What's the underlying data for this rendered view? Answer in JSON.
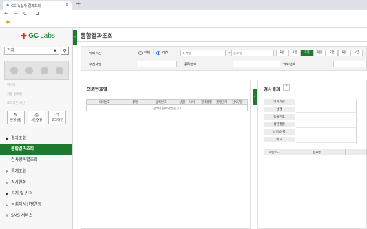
{
  "browser": {
    "tab_title": "GC 녹십자 결과조회",
    "new_tab": "+",
    "nav_back": "←",
    "nav_forward": "→",
    "nav_reload": "C"
  },
  "sidebar": {
    "logo_text_gc": "GC",
    "logo_text_labs": "Labs",
    "select_value": "전체",
    "links": [
      "마이디",
      "최종 접속일",
      "로그아웃 시간"
    ],
    "buttons": [
      "환경설정",
      "서인연장",
      "로그아웃"
    ],
    "menu": [
      {
        "label": "결과조회",
        "icon": "person-icon"
      },
      {
        "label": "통합결과조회",
        "active": true
      },
      {
        "label": "검사항목별조회"
      },
      {
        "label": "통계조회",
        "icon": "search-icon"
      },
      {
        "label": "검사현황",
        "icon": "list-icon"
      },
      {
        "label": "공지 및 신청",
        "icon": "chat-icon"
      },
      {
        "label": "녹십자서신쟁연동",
        "icon": "sync-icon"
      },
      {
        "label": "SMS 서비스",
        "icon": "mail-icon"
      }
    ]
  },
  "main": {
    "title": "통합결과조회",
    "filters": {
      "period_label": "의뢰기간",
      "radio_all": "전체",
      "radio_period": "기간",
      "start_placeholder": "시작일",
      "end_placeholder": "종료일",
      "tilde": "~",
      "patient_label": "수진자명",
      "reg_label": "등록번호",
      "req_label": "의뢰번호",
      "period_buttons": [
        "1일",
        "3일",
        "1개",
        "1달",
        "3달",
        "6달",
        "1년"
      ]
    },
    "left_panel": {
      "title": "의뢰번호별",
      "columns": [
        "의뢰번호",
        "성명",
        "등록번호",
        "성별",
        "나이",
        "결과유형",
        "진행단계",
        "검사구분"
      ],
      "empty_text": "검색이 된로되었습니다"
    },
    "right_panel": {
      "title": "검사결과",
      "fields": [
        "의뢰기관",
        "성명",
        "등록번호",
        "생년월일",
        "나이/성별",
        "비고"
      ],
      "columns": [
        "보험코드",
        "검사명"
      ]
    }
  }
}
